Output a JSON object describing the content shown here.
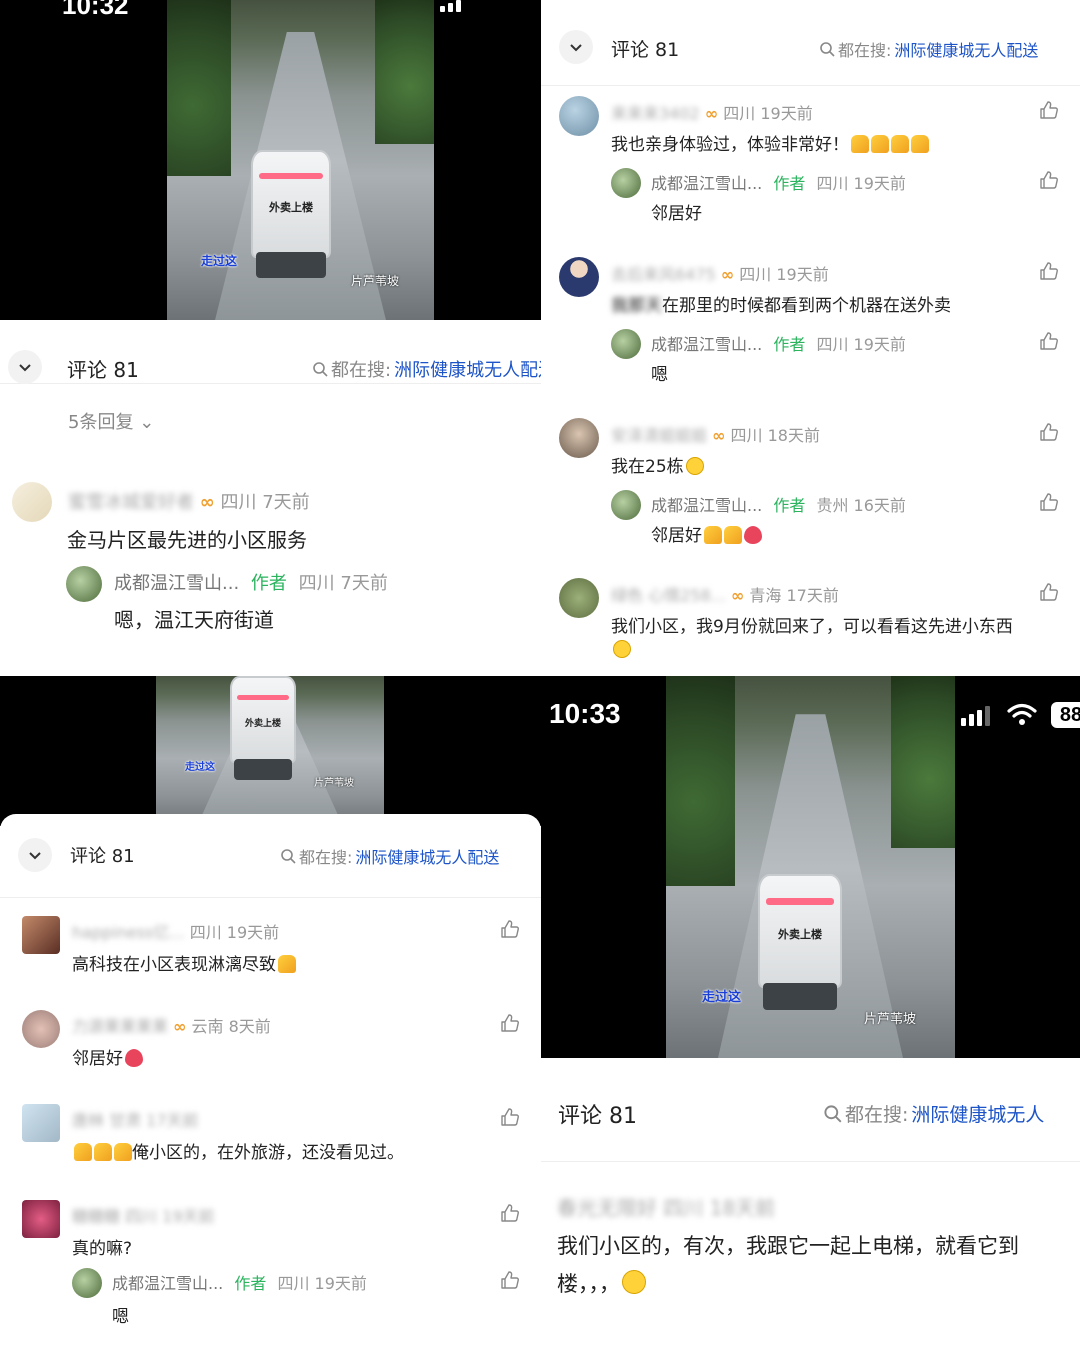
{
  "video": {
    "robot_label": "外卖上楼",
    "caption_walk": "走过这",
    "caption_slope": "片芦苇坡"
  },
  "status_tl": {
    "time": "10:32"
  },
  "status_br": {
    "time": "10:33",
    "battery": "88"
  },
  "sheet": {
    "count": "评论 81",
    "search_prefix": "都在搜:",
    "search_keyword": "洲际健康城无人配送",
    "search_keyword_short": "洲际健康城无人"
  },
  "top_left": {
    "replies": "5条回复",
    "comment": {
      "name": "蜜雪冰城爱好者",
      "badge": "∞",
      "meta": "四川 7天前",
      "text": "金马片区最先进的小区服务"
    },
    "reply": {
      "name": "成都温江雪山...",
      "author": "作者",
      "meta": "四川 7天前",
      "text": "嗯，温江天府街道"
    }
  },
  "top_right": {
    "comments": [
      {
        "name": "来来来3402",
        "badge": "∞",
        "meta": "四川 19天前",
        "text": "我也亲身体验过，体验非常好！",
        "reply": {
          "name": "成都温江雪山...",
          "author": "作者",
          "meta": "四川 19天前",
          "text": "邻居好"
        }
      },
      {
        "name": "去后来风6475",
        "badge": "∞",
        "meta": "四川 19天前",
        "text_blur": "我那天",
        "text": "在那里的时候都看到两个机器在送外卖",
        "reply": {
          "name": "成都温江雪山...",
          "author": "作者",
          "meta": "四川 19天前",
          "text": "嗯"
        }
      },
      {
        "name": "安泽清姐姐姐",
        "badge": "∞",
        "meta": "四川 18天前",
        "text": "我在25栋",
        "reply": {
          "name": "成都温江雪山...",
          "author": "作者",
          "meta": "贵州 16天前",
          "text": "邻居好"
        }
      },
      {
        "name": "绿色 心情258...",
        "badge": "∞",
        "meta": "青海 17天前",
        "text": "我们小区，我9月份就回来了，可以看看这先进小东西"
      }
    ]
  },
  "bottom_left": {
    "comments": [
      {
        "name": "happiness亿...",
        "meta": "四川 19天前",
        "text": "高科技在小区表现淋漓尽致"
      },
      {
        "name": "力源果果果果",
        "badge": "∞",
        "meta": "云南 8天前",
        "text": "邻居好"
      },
      {
        "name": "唐林 甘肃 17天前",
        "meta": "",
        "text": "俺小区的，在外旅游，还没看见过。"
      },
      {
        "name": "糖糖糖 四川 19天前",
        "meta": "",
        "text": "真的嘛?",
        "reply": {
          "name": "成都温江雪山...",
          "author": "作者",
          "meta": "四川 19天前",
          "text": "嗯"
        }
      }
    ]
  },
  "bottom_right": {
    "comment": {
      "name": "春光无限好 四川 18天前",
      "line1": "我们小区的，有次，我跟它一起上电梯，就看它到",
      "line2": "楼，，，"
    }
  }
}
